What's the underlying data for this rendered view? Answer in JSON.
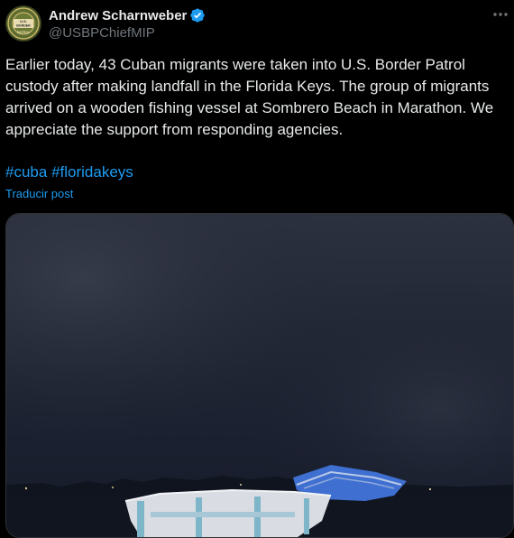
{
  "author": {
    "display_name": "Andrew Scharnweber",
    "handle": "@USBPChiefMIP",
    "avatar_icon": "border-patrol-badge-icon",
    "verified_icon": "verified-badge-icon",
    "verified_color": "#1d9bf0"
  },
  "menu": {
    "more_icon": "more-horizontal-icon"
  },
  "tweet": {
    "text": "Earlier today, 43 Cuban migrants were taken into U.S. Border Patrol custody after making landfall in the Florida Keys. The group of migrants arrived on a wooden fishing vessel at Sombrero Beach in Marathon. We appreciate the support from responding agencies.",
    "hashtags": [
      "#cuba",
      "#floridakeys"
    ],
    "translate_label": "Traducir post"
  },
  "media": {
    "description_icon": "night-beach-boat-photo"
  },
  "colors": {
    "background": "#000000",
    "text": "#e7e9ea",
    "secondary": "#71767b",
    "link": "#1d9bf0"
  }
}
